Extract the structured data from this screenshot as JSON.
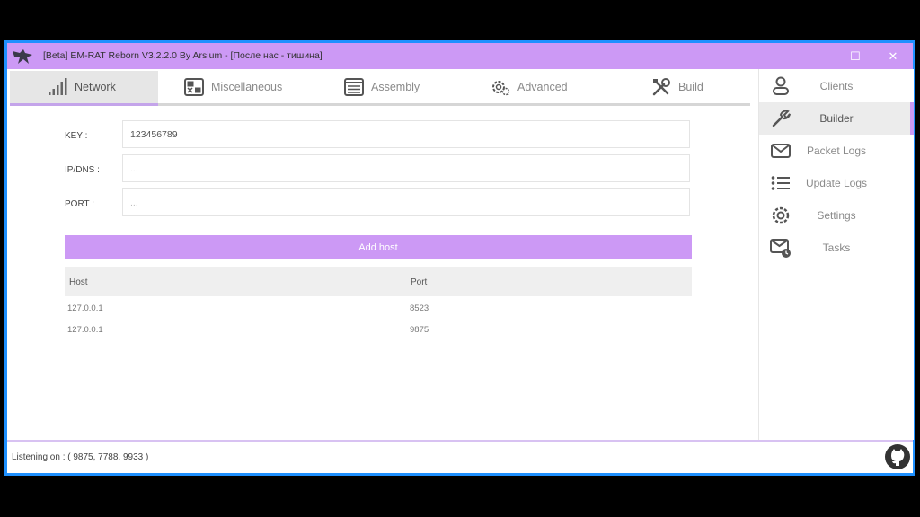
{
  "window": {
    "title": "[Beta] EM-RAT Reborn V3.2.2.0 By Arsium - [После нас - тишина]",
    "controls": {
      "minimize": "—",
      "maximize": "☐",
      "close": "✕"
    }
  },
  "tabs": [
    {
      "label": "Network",
      "icon": "signal-bars-icon",
      "active": true
    },
    {
      "label": "Miscellaneous",
      "icon": "misc-grid-icon",
      "active": false
    },
    {
      "label": "Assembly",
      "icon": "list-window-icon",
      "active": false
    },
    {
      "label": "Advanced",
      "icon": "gears-icon",
      "active": false
    },
    {
      "label": "Build",
      "icon": "tools-icon",
      "active": false
    }
  ],
  "form": {
    "key_label": "KEY :",
    "key_value": "123456789",
    "ip_label": "IP/DNS :",
    "ip_placeholder": "...",
    "port_label": "PORT :",
    "port_placeholder": "...",
    "add_host_label": "Add host"
  },
  "hosts_table": {
    "columns": [
      "Host",
      "Port"
    ],
    "rows": [
      {
        "host": "127.0.0.1",
        "port": "8523"
      },
      {
        "host": "127.0.0.1",
        "port": "9875"
      }
    ]
  },
  "sidebar": {
    "items": [
      {
        "label": "Clients",
        "icon": "user-icon",
        "active": false
      },
      {
        "label": "Builder",
        "icon": "wrench-icon",
        "active": true
      },
      {
        "label": "Packet Logs",
        "icon": "envelope-icon",
        "active": false
      },
      {
        "label": "Update Logs",
        "icon": "list-icon",
        "active": false
      },
      {
        "label": "Settings",
        "icon": "gear-icon",
        "active": false
      },
      {
        "label": "Tasks",
        "icon": "mail-clock-icon",
        "active": false
      }
    ]
  },
  "status": {
    "text": "Listening on : ( 9875, 7788, 9933 )"
  },
  "colors": {
    "accent": "#cc99f5",
    "frame": "#1e90ff"
  }
}
